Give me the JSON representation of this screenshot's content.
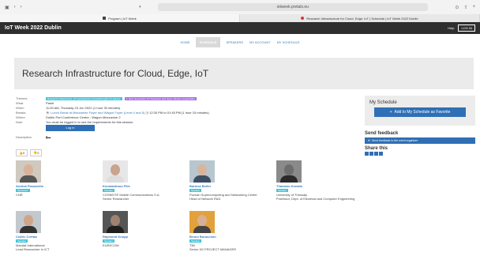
{
  "browser": {
    "url": "iotweek.pretalx.eu",
    "tabs": [
      {
        "label": "Program | IoT Week"
      },
      {
        "label": "Research Infrastructure for Cloud, Edge, IoT | Schedule | IoT Week 2022 Dublin"
      }
    ]
  },
  "site": {
    "brand": "IoT Week 2022 Dublin",
    "help": "Help",
    "login": "LOG IN"
  },
  "nav": [
    "HOME",
    "SCHEDULE",
    "SPEAKERS",
    "MY ACCOUNT",
    "MY SCHEDULE"
  ],
  "session": {
    "title": "Research Infrastructure for Cloud, Edge, IoT",
    "themes_label": "Themes",
    "themes": [
      "Research infrastructure, IoT perspectives & breakthroughs for Europe",
      "3. Next Generation IoT: Research and Open Industry Cooperation"
    ],
    "what_label": "What",
    "what": "Panel",
    "when_label": "When",
    "when": "11:00 AM, Thursday 23 Jun 2022 (1 hour 30 minutes)",
    "breaks_label": "Breaks",
    "break_main": "Lunch Break at Mezzanine Foyer and Wagon Foyer (Level 4 and 5)",
    "break_time": "12:30 PM to 01:45 PM (1 hour 15 minutes)",
    "where_label": "Where",
    "where": "Dublin Port Conference Centre - Wagon Mezzanine 2",
    "note_label": "Note",
    "note": "You must be logged in to see the requirements for this session.",
    "login_button": "Log in",
    "description_label": "Description",
    "upvotes": "0",
    "downvotes": "0"
  },
  "sidebar": {
    "schedule_header": "My Schedule",
    "favorite_button": "Add to My Schedule as Favorite",
    "feedback_header": "Send feedback",
    "feedback_button": "Send feedback to the event organizer",
    "share_header": "Share this"
  },
  "speakers": [
    {
      "name": "Andrea Passarella",
      "role": "Moderator",
      "org": "CNR"
    },
    {
      "name": "Konstantinos Filis",
      "role": "Speaker",
      "org": "COSMOTE Mobile Communications S.A.",
      "title": "Senior Researcher"
    },
    {
      "name": "Bartosz Belter",
      "role": "Speaker",
      "org": "Poznan Supercomputing and Networking Center",
      "title": "Head of Network R&D"
    },
    {
      "name": "Thanasis Korakis",
      "role": "Speaker",
      "org": "University of Thessaly",
      "title": "Professor, Dept. of Electrical and Computer Engineering"
    },
    {
      "name": "Cédric Crettaz",
      "role": "Speaker",
      "org": "Mandat International",
      "title": "Lead Researcher in ICT"
    },
    {
      "name": "Raymond Knopp",
      "role": "Speaker",
      "org": "EURECOM"
    },
    {
      "name": "Bruno Buracchini",
      "role": "Speaker",
      "org": "TIM",
      "title": "Senior 5G PROJECT MANAGER"
    }
  ],
  "colors": {
    "accent": "#2f6fb5",
    "tag_cyan": "#41c4d8",
    "tag_violet": "#a86ee8",
    "topbar": "#2f2f2f"
  }
}
